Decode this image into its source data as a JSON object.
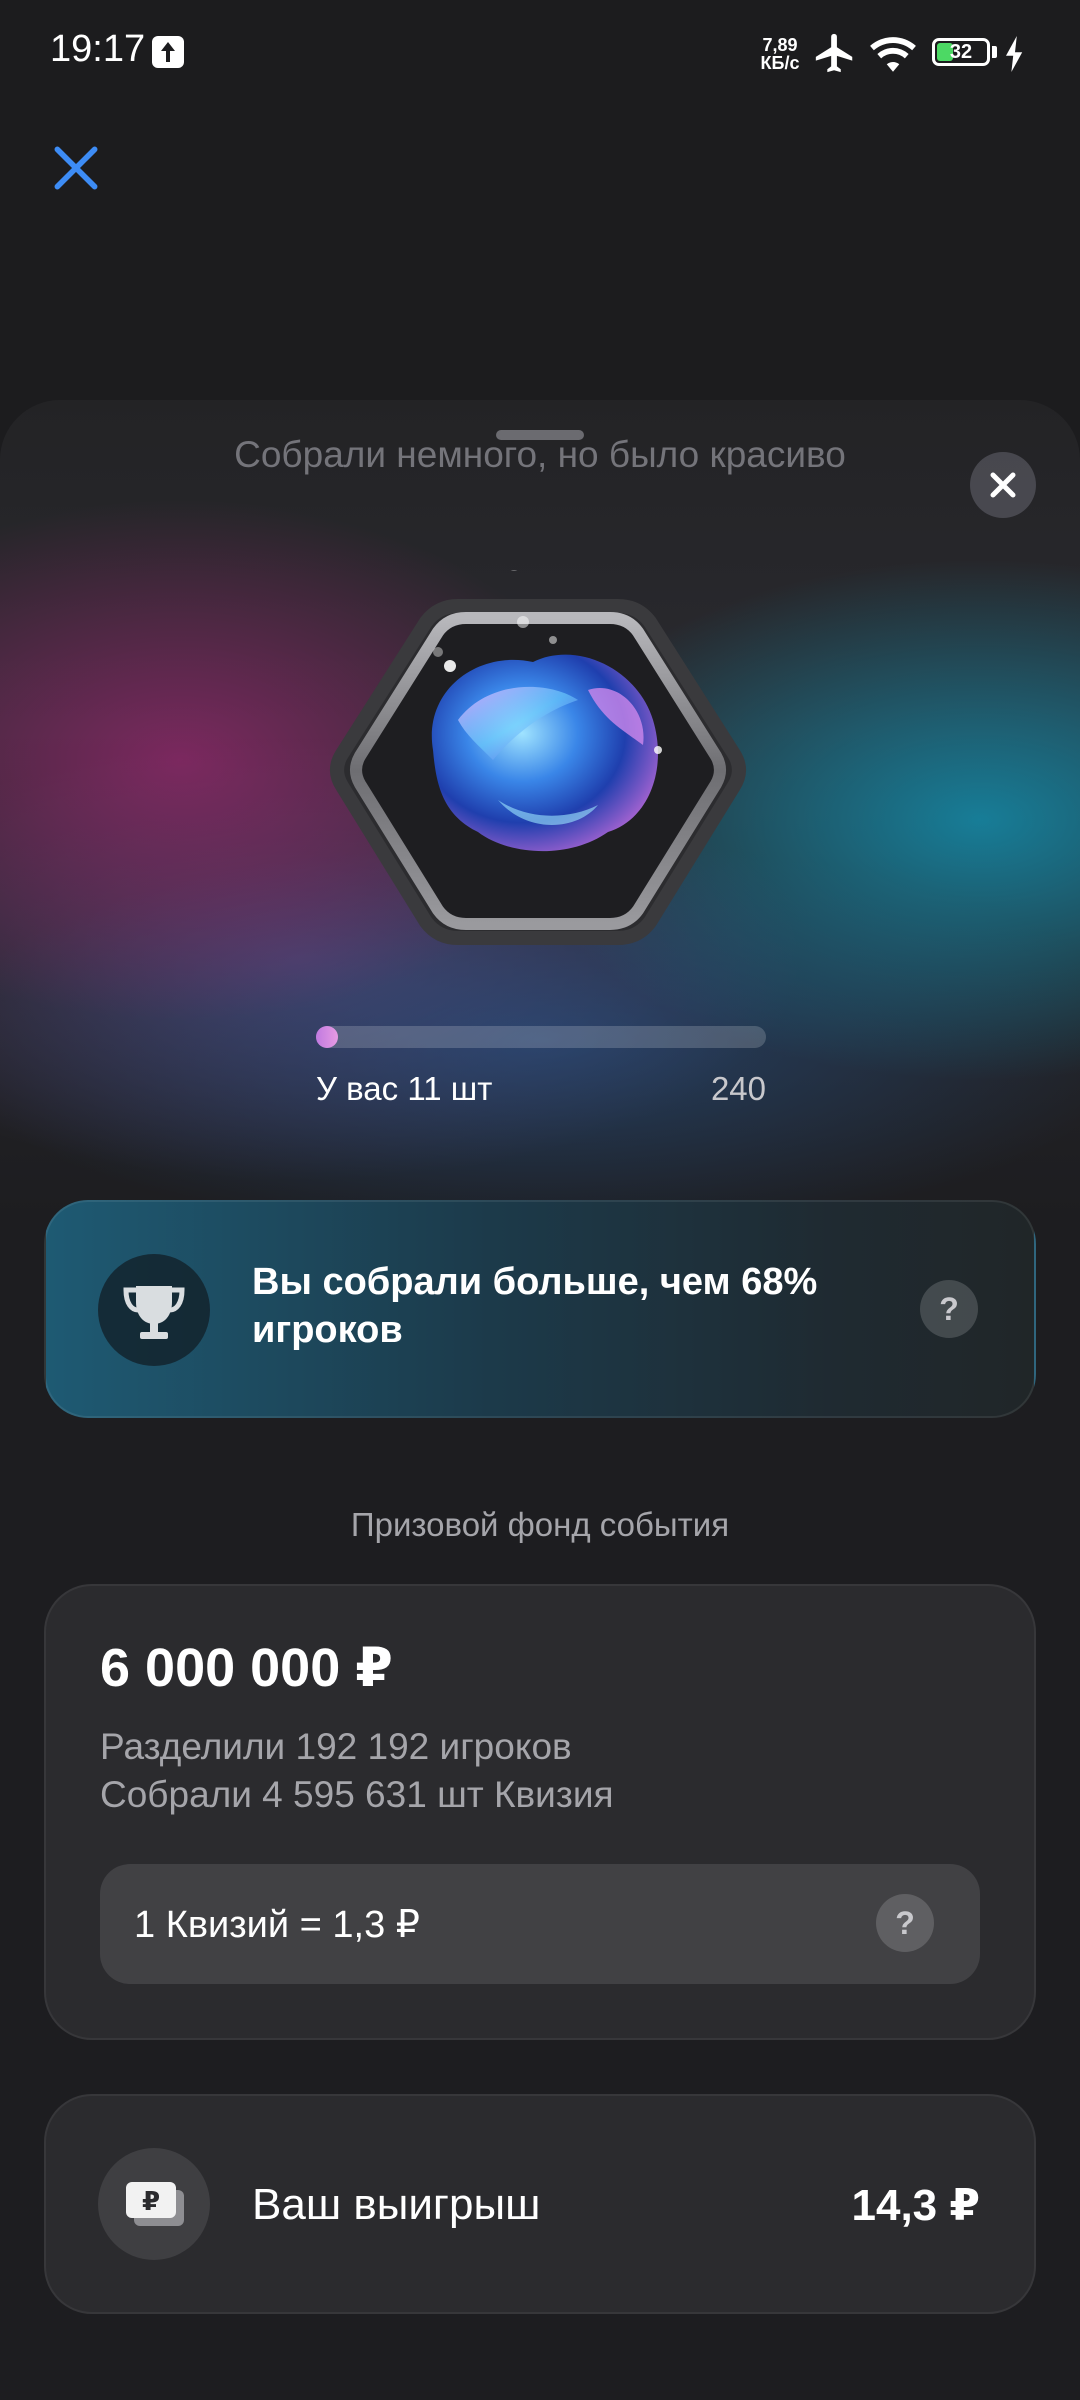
{
  "status_bar": {
    "time": "19:17",
    "speed_value": "7,89",
    "speed_unit": "КБ/с",
    "battery": "32"
  },
  "sheet": {
    "title": "Собрали немного, но было красиво"
  },
  "collection": {
    "you_have": "У вас 11 шт",
    "goal": "240",
    "progress_fraction": 0.046
  },
  "rank": {
    "text": "Вы собрали больше, чем 68% игроков",
    "help": "?"
  },
  "prize": {
    "caption": "Призовой фонд события",
    "amount": "6 000 000 ₽",
    "players_line": "Разделили 192 192 игроков",
    "collected_line": "Собрали 4 595 631 шт Квизия",
    "rate": "1 Квизий = 1,3 ₽",
    "help": "?"
  },
  "winnings": {
    "label": "Ваш выигрыш",
    "value": "14,3 ₽",
    "icon_glyph": "₽"
  },
  "colors": {
    "accent_blue": "#3d8cf5",
    "progress": "#d98ee4",
    "teal": "#1e5a73"
  }
}
